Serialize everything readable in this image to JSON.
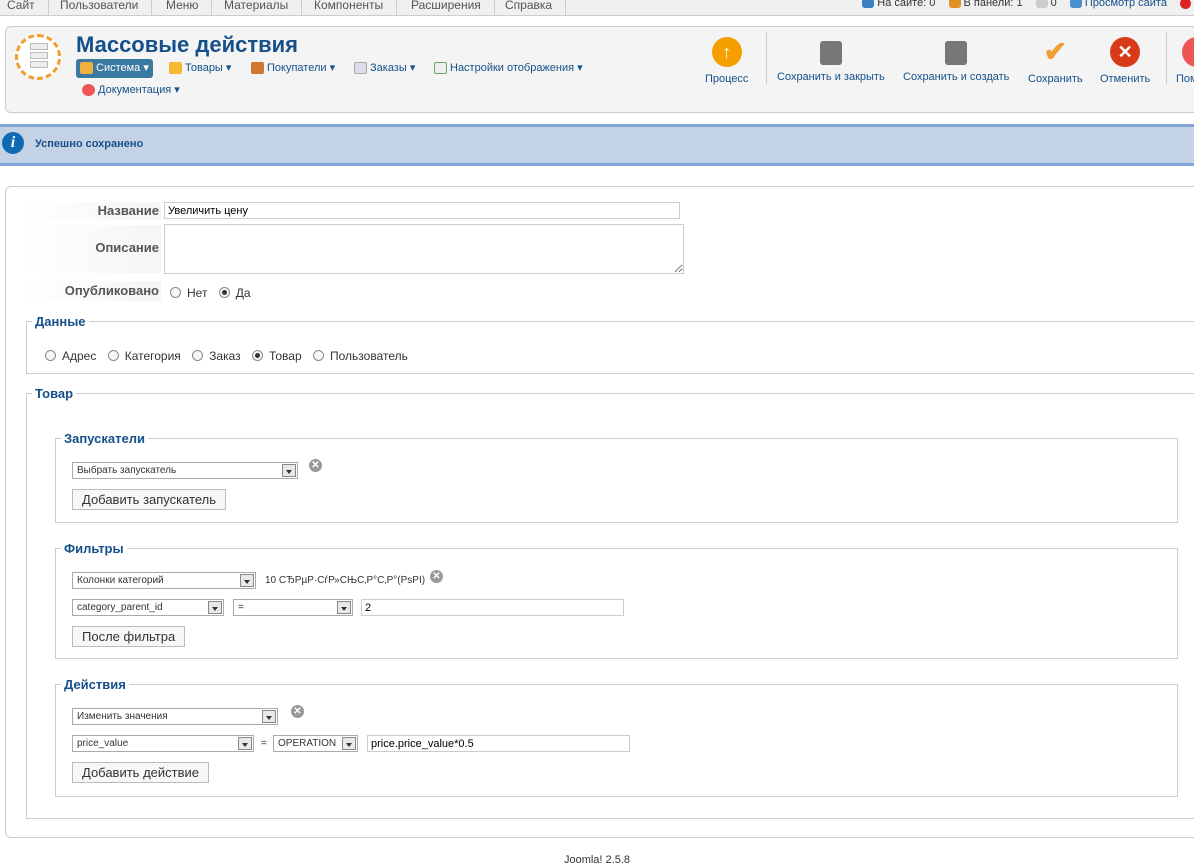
{
  "topmenu": [
    "Сайт",
    "Пользователи",
    "Меню",
    "Материалы",
    "Компоненты",
    "Расширения",
    "Справка"
  ],
  "status": {
    "on_site": "На сайте: 0",
    "in_panel": "В панели: 1",
    "messages": "0",
    "view_site": "Просмотр сайта"
  },
  "header": {
    "title": "Массовые действия",
    "submenu": [
      "Система",
      "Товары",
      "Покупатели",
      "Заказы",
      "Настройки отображения",
      "Документация"
    ]
  },
  "toolbar": {
    "process": "Процесс",
    "save_close": "Сохранить и закрыть",
    "save_new": "Сохранить и создать",
    "save": "Сохранить",
    "cancel": "Отменить",
    "help": "Помощь"
  },
  "message": "Успешно сохранено",
  "form": {
    "name_label": "Название",
    "name_value": "Увеличить цену",
    "desc_label": "Описание",
    "published_label": "Опубликовано",
    "no": "Нет",
    "yes": "Да"
  },
  "data_section": {
    "legend": "Данные",
    "options": [
      "Адрес",
      "Категория",
      "Заказ",
      "Товар",
      "Пользователь"
    ],
    "selected": "Товар"
  },
  "product": {
    "legend": "Товар",
    "triggers": {
      "legend": "Запускатели",
      "select": "Выбрать запускатель",
      "add": "Добавить запускатель"
    },
    "filters": {
      "legend": "Фильтры",
      "select": "Колонки категорий",
      "result": "10 СЂРµР·СѓР»СЊС‚Р°С‚Р°(РѕРІ)",
      "field": "category_parent_id",
      "operator": "=",
      "value": "2",
      "add": "После фильтра"
    },
    "actions": {
      "legend": "Действия",
      "select": "Изменить значения",
      "field": "price_value",
      "eq": "=",
      "op": "OPERATION",
      "value": "price.price_value*0.5",
      "add": "Добавить действие"
    }
  },
  "footer": "Joomla! 2.5.8"
}
